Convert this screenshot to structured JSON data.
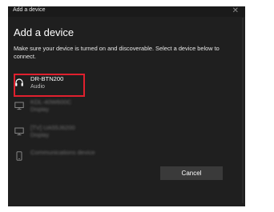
{
  "window": {
    "title": "Add a device",
    "close_glyph": "✕"
  },
  "heading": "Add a device",
  "instructions": "Make sure your device is turned on and discoverable. Select a device below to connect.",
  "devices": [
    {
      "name": "DR-BTN200",
      "type": "Audio",
      "icon": "headphones-icon",
      "highlighted": true
    },
    {
      "name": "KDL-40W600C",
      "type": "Display",
      "icon": "display-icon"
    },
    {
      "name": "[TV] UA55J6200",
      "type": "Display",
      "icon": "display-icon"
    },
    {
      "name": "Communications device",
      "type": "",
      "icon": "phone-icon"
    }
  ],
  "buttons": {
    "cancel": "Cancel"
  },
  "colors": {
    "dialog_bg": "#1f1f1f",
    "highlight_border": "#e0202e",
    "button_bg": "#3a3a3a"
  }
}
